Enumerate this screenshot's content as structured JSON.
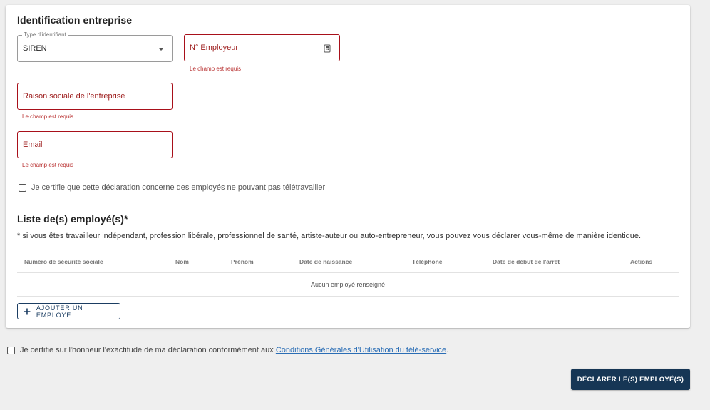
{
  "company": {
    "title": "Identification entreprise",
    "id_type": {
      "legend": "Type d'identifiant",
      "value": "SIREN"
    },
    "employer_number": {
      "placeholder": "N° Employeur",
      "error": "Le champ est requis"
    },
    "company_name": {
      "placeholder": "Raison sociale de l'entreprise",
      "error": "Le champ est requis"
    },
    "email": {
      "placeholder": "Email",
      "error": "Le champ est requis"
    },
    "telework_certify": "Je certifie que cette déclaration concerne des employés ne pouvant pas télétravailler"
  },
  "employees": {
    "title": "Liste de(s) employé(s)*",
    "note": "* si vous êtes travailleur indépendant, profession libérale, professionnel de santé, artiste-auteur ou auto-entrepreneur, vous pouvez vous déclarer vous-même de manière identique.",
    "columns": [
      "Numéro de sécurité sociale",
      "Nom",
      "Prénom",
      "Date de naissance",
      "Téléphone",
      "Date de début de l'arrêt",
      "Actions"
    ],
    "empty": "Aucun employé renseigné",
    "add_button": "AJOUTER UN EMPLOYÉ"
  },
  "footer": {
    "certify_prefix": "Je certifie sur l'honneur l'exactitude de ma déclaration conformément aux ",
    "certify_link": "Conditions Générales d'Utilisation du télé-service",
    "certify_suffix": ".",
    "submit": "DÉCLARER LE(S) EMPLOYÉ(S)"
  },
  "colors": {
    "error": "#a8101a",
    "primary": "#163655",
    "link": "#2a6db5"
  }
}
